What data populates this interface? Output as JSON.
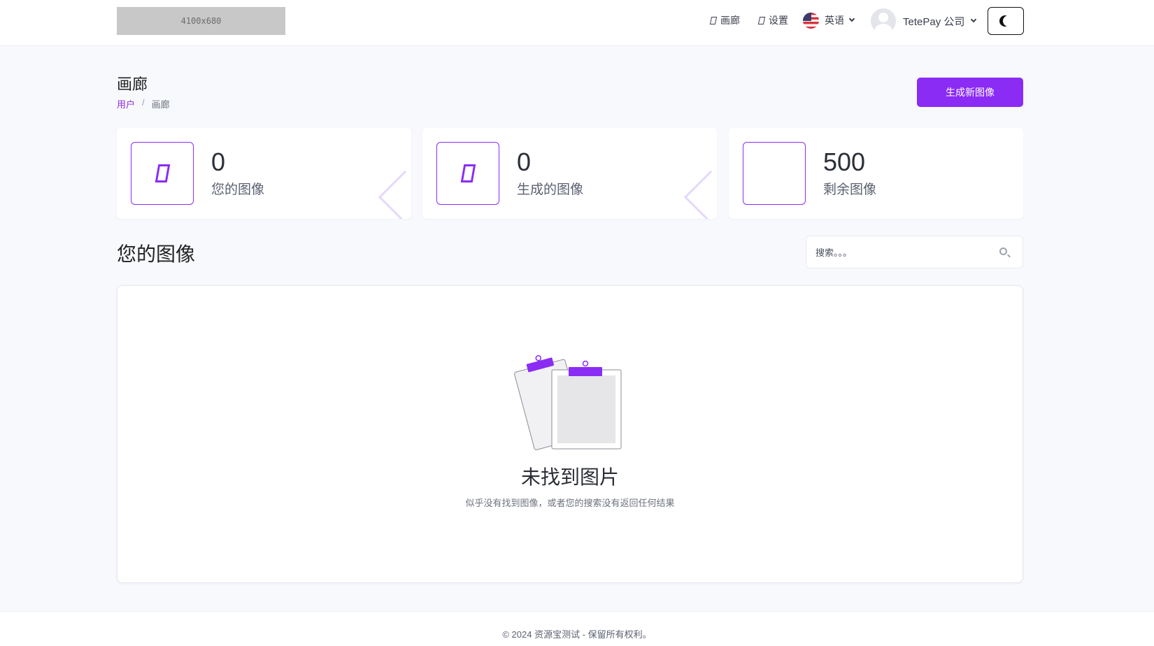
{
  "header": {
    "logo_placeholder": "4100x680",
    "nav": [
      {
        "label": "画廊",
        "icon": "gallery-icon"
      },
      {
        "label": "设置",
        "icon": "settings-icon"
      }
    ],
    "language": {
      "label": "英语",
      "icon": "us-flag-icon"
    },
    "user": {
      "name": "TetePay 公司",
      "icon": "avatar-icon"
    },
    "theme_toggle_icon": "moon-icon"
  },
  "page": {
    "title": "画廊",
    "breadcrumb": {
      "home": "用户",
      "separator": "/",
      "current": "画廊"
    },
    "primary_action": "生成新图像"
  },
  "stats": [
    {
      "value": "0",
      "label": "您的图像",
      "icon": "image-icon"
    },
    {
      "value": "0",
      "label": "生成的图像",
      "icon": "image-icon"
    },
    {
      "value": "500",
      "label": "剩余图像",
      "icon": ""
    }
  ],
  "section": {
    "title": "您的图像",
    "search_placeholder": "搜索。。。"
  },
  "empty_state": {
    "title": "未找到图片",
    "description": "似乎没有找到图像，或者您的搜索没有返回任何结果",
    "icon": "clipboard-empty-icon"
  },
  "footer": {
    "text": "© 2024 资源宝测试 - 保留所有权利。"
  },
  "colors": {
    "accent": "#8b2cf5",
    "background": "#f8f9fd"
  }
}
